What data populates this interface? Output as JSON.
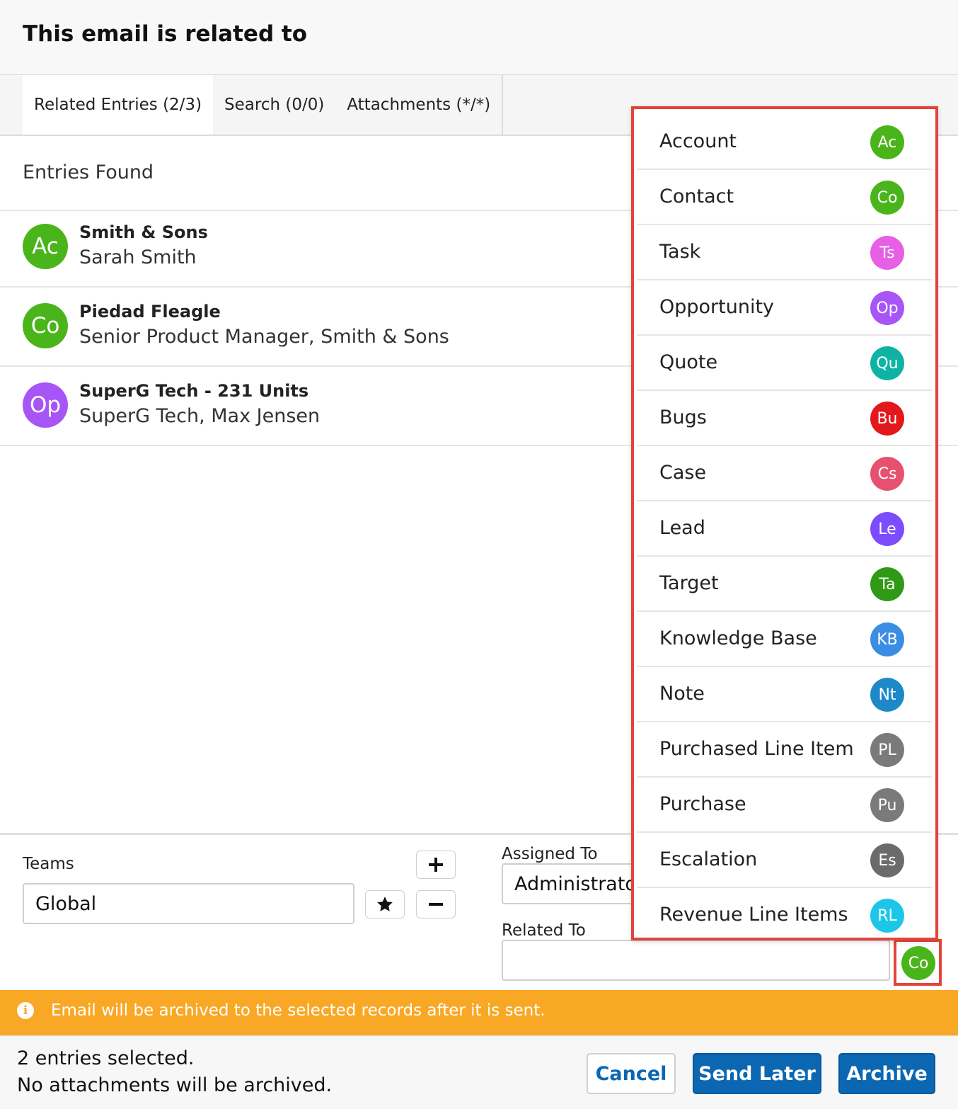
{
  "dialog": {
    "title": "This email is related to"
  },
  "tabs": [
    {
      "label": "Related Entries (2/3)",
      "active": true
    },
    {
      "label": "Search (0/0)",
      "active": false
    },
    {
      "label": "Attachments (*/*)",
      "active": false
    }
  ],
  "entries_header": "Entries Found",
  "entries": [
    {
      "badge": "Ac",
      "color": "#4ab51b",
      "name": "Smith & Sons",
      "sub": "Sarah Smith"
    },
    {
      "badge": "Co",
      "color": "#4ab51b",
      "name": "Piedad Fleagle",
      "sub": "Senior Product Manager, Smith & Sons"
    },
    {
      "badge": "Op",
      "color": "#a855f7",
      "name": "SuperG Tech - 231 Units",
      "sub": "SuperG Tech, Max Jensen"
    }
  ],
  "form": {
    "teams_label": "Teams",
    "teams_value": "Global",
    "assigned_label": "Assigned To",
    "assigned_value": "Administrator",
    "related_label": "Related To",
    "related_value": ""
  },
  "module_dropdown": [
    {
      "label": "Account",
      "badge": "Ac",
      "color": "#4ab51b"
    },
    {
      "label": "Contact",
      "badge": "Co",
      "color": "#4ab51b"
    },
    {
      "label": "Task",
      "badge": "Ts",
      "color": "#e65fe4"
    },
    {
      "label": "Opportunity",
      "badge": "Op",
      "color": "#a855f7"
    },
    {
      "label": "Quote",
      "badge": "Qu",
      "color": "#0fb3a3"
    },
    {
      "label": "Bugs",
      "badge": "Bu",
      "color": "#e3181b"
    },
    {
      "label": "Case",
      "badge": "Cs",
      "color": "#e8506f"
    },
    {
      "label": "Lead",
      "badge": "Le",
      "color": "#7c4dff"
    },
    {
      "label": "Target",
      "badge": "Ta",
      "color": "#2e9a16"
    },
    {
      "label": "Knowledge Base",
      "badge": "KB",
      "color": "#3b8de3"
    },
    {
      "label": "Note",
      "badge": "Nt",
      "color": "#1d89c9"
    },
    {
      "label": "Purchased Line Item",
      "badge": "PL",
      "color": "#7a7a7a"
    },
    {
      "label": "Purchase",
      "badge": "Pu",
      "color": "#7a7a7a"
    },
    {
      "label": "Escalation",
      "badge": "Es",
      "color": "#6b6b6b"
    },
    {
      "label": "Revenue Line Items",
      "badge": "RL",
      "color": "#1cc6e8"
    }
  ],
  "module_picker": {
    "badge": "Co",
    "color": "#4ab51b"
  },
  "banner": {
    "message": "Email will be archived to the selected records after it is sent."
  },
  "footer": {
    "status_line1": "2 entries selected.",
    "status_line2": "No attachments will be archived.",
    "cancel_label": "Cancel",
    "send_later_label": "Send Later",
    "archive_label": "Archive"
  }
}
